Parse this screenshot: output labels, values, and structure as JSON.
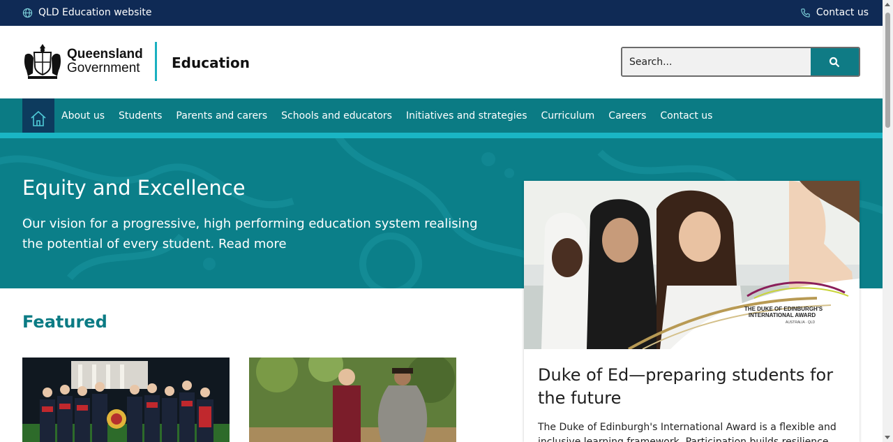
{
  "topbar": {
    "site_link": "QLD Education website",
    "site_icon": "globe-icon",
    "contact_link": "Contact us",
    "contact_icon": "phone-icon"
  },
  "header": {
    "logo_line1": "Queensland",
    "logo_line2": "Government",
    "site_name": "Education",
    "search_placeholder": "Search...",
    "search_icon": "search-icon"
  },
  "nav": {
    "home_icon": "home-icon",
    "items": [
      {
        "label": "About us"
      },
      {
        "label": "Students"
      },
      {
        "label": "Parents and carers"
      },
      {
        "label": "Schools and educators"
      },
      {
        "label": "Initiatives and strategies"
      },
      {
        "label": "Curriculum"
      },
      {
        "label": "Careers"
      },
      {
        "label": "Contact us"
      }
    ]
  },
  "hero": {
    "title": "Equity and Excellence",
    "text": "Our vision for a progressive, high performing education system realising the potential of every student. Read more"
  },
  "featured": {
    "title": "Featured"
  },
  "card": {
    "title": "Duke of Ed—preparing students for the future",
    "text": "The Duke of Edinburgh's International Award is a flexible and inclusive learning framework. Participation builds resilience",
    "badge_line1": "THE DUKE OF EDINBURGH'S",
    "badge_line2": "INTERNATIONAL AWARD",
    "badge_line3": "AUSTRALIA · QLD"
  },
  "colors": {
    "topbar": "#0f2a55",
    "teal": "#0b7b84",
    "accent": "#1ab5c4",
    "home_bg": "#0d3b5e"
  }
}
